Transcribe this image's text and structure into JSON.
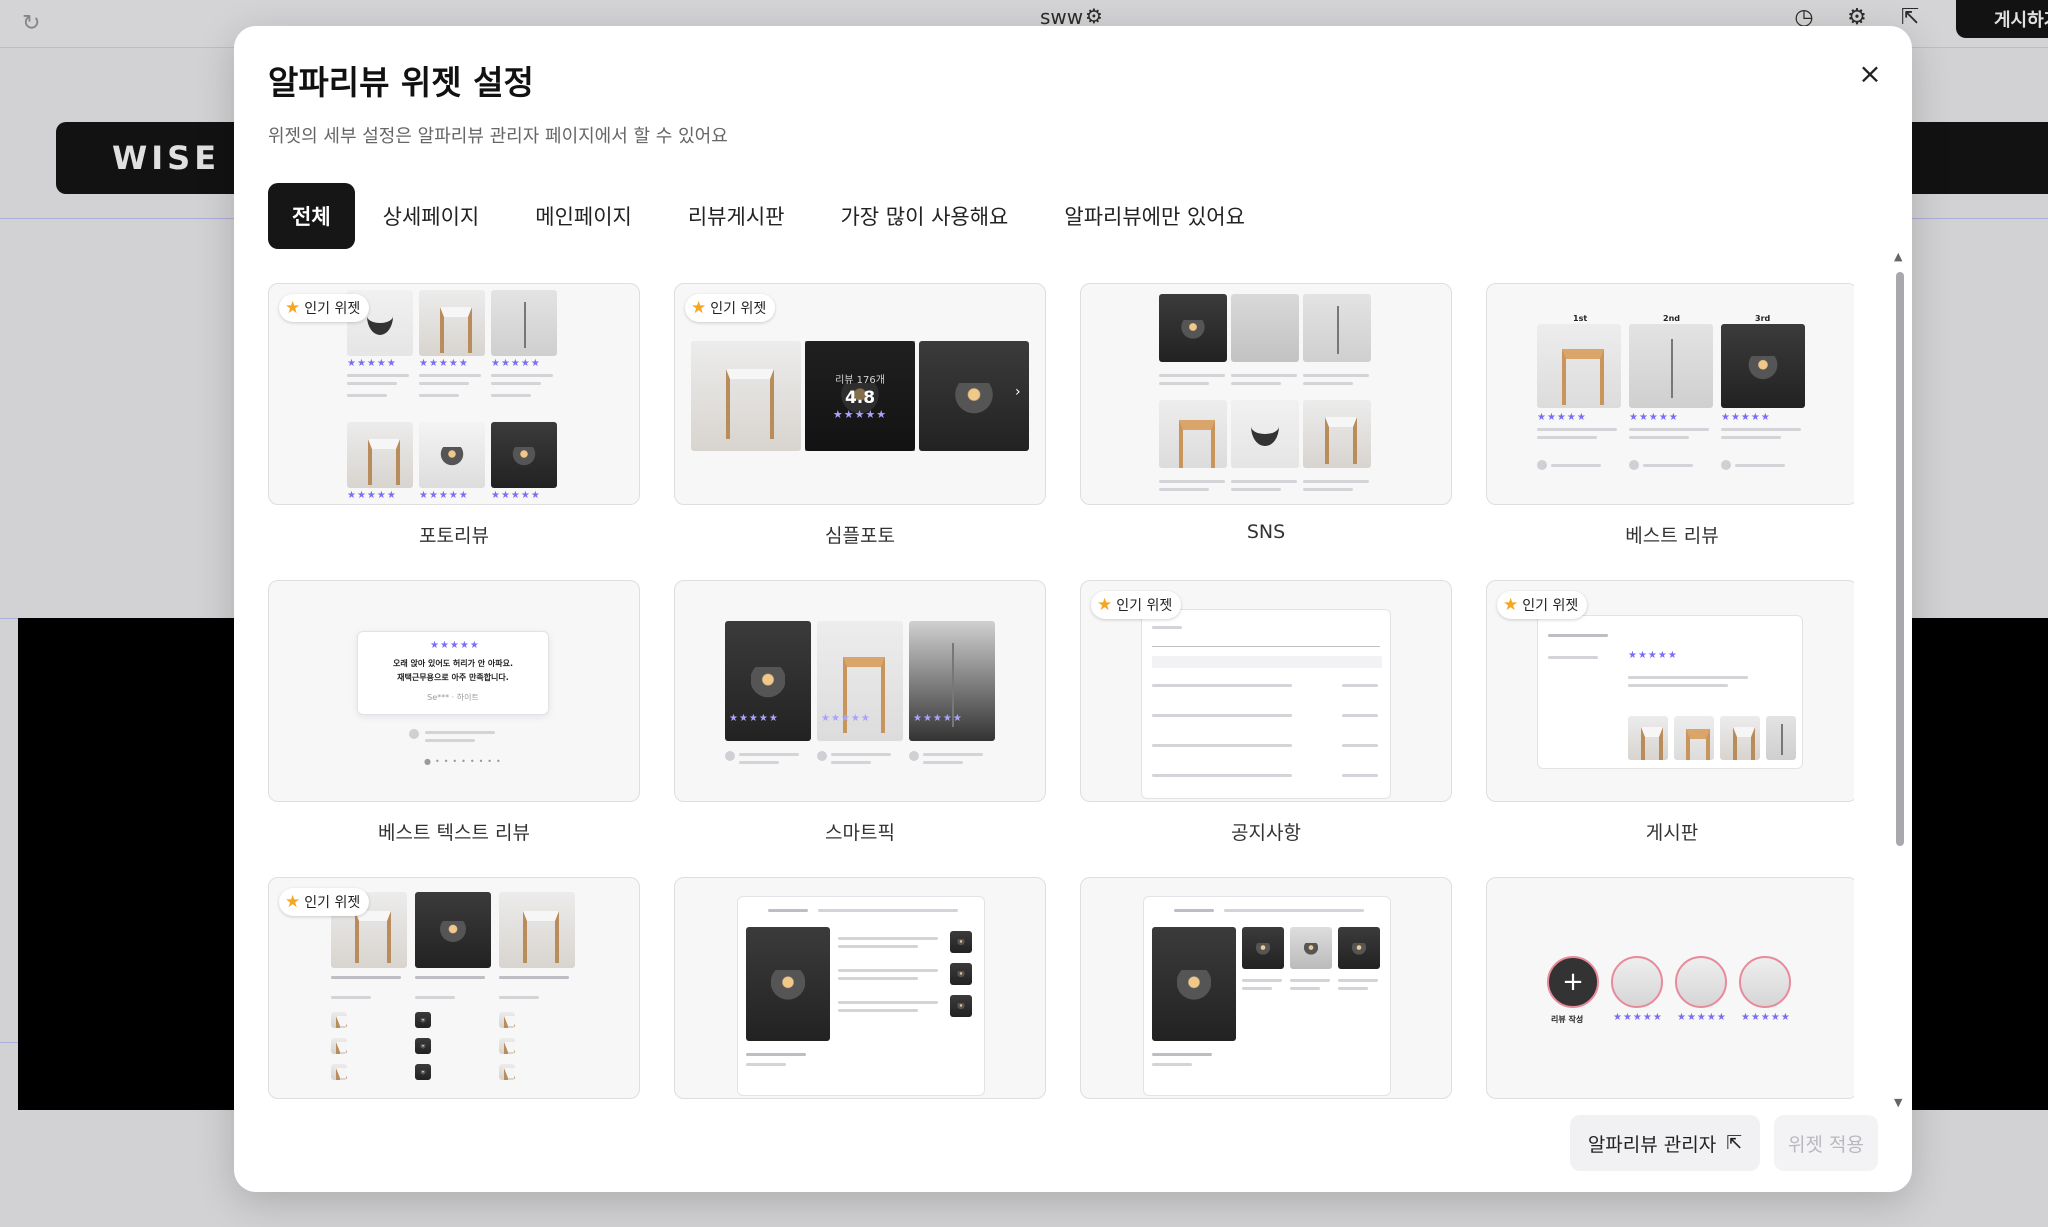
{
  "topbar": {
    "site_name": "sww",
    "publish_label": "게시하기"
  },
  "background": {
    "logo_text": "WISE"
  },
  "modal": {
    "title": "알파리뷰 위젯 설정",
    "subtitle": "위젯의 세부 설정은 알파리뷰 관리자 페이지에서 할 수 있어요",
    "close_symbol": "×",
    "tabs": [
      {
        "label": "전체",
        "active": true
      },
      {
        "label": "상세페이지",
        "active": false
      },
      {
        "label": "메인페이지",
        "active": false
      },
      {
        "label": "리뷰게시판",
        "active": false
      },
      {
        "label": "가장 많이 사용해요",
        "active": false
      },
      {
        "label": "알파리뷰에만 있어요",
        "active": false
      }
    ],
    "badge_label": "인기 위젯",
    "widgets": [
      {
        "name": "포토리뷰",
        "popular": true
      },
      {
        "name": "심플포토",
        "popular": true
      },
      {
        "name": "SNS",
        "popular": false
      },
      {
        "name": "베스트 리뷰",
        "popular": false
      },
      {
        "name": "베스트 텍스트 리뷰",
        "popular": false
      },
      {
        "name": "스마트픽",
        "popular": false
      },
      {
        "name": "공지사항",
        "popular": true
      },
      {
        "name": "게시판",
        "popular": true
      },
      {
        "name": "",
        "popular": true
      },
      {
        "name": "",
        "popular": false
      },
      {
        "name": "",
        "popular": false
      },
      {
        "name": "",
        "popular": false
      }
    ],
    "simple_photo": {
      "count_text": "리뷰 176개",
      "score": "4.8",
      "stars": "★★★★★"
    },
    "best_text_review": {
      "quote_line1": "오래 앉아 있어도 허리가 안 아파요.",
      "quote_line2": "재택근무용으로 아주 만족합니다.",
      "author": "Se*** · 하이트"
    },
    "best_review_ranks": [
      "1st",
      "2nd",
      "3rd"
    ],
    "story": {
      "write_label": "리뷰 작성"
    },
    "footer": {
      "admin_button": "알파리뷰 관리자",
      "apply_button": "위젯 적용"
    }
  }
}
